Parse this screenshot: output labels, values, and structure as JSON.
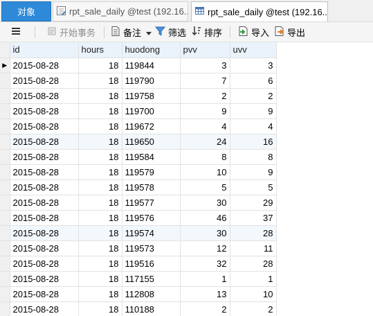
{
  "tabs": [
    {
      "label": "对象",
      "icon": "none"
    },
    {
      "label": "rpt_sale_daily @test (192.16...",
      "icon": "query-icon"
    },
    {
      "label": "rpt_sale_daily @test (192.16...",
      "icon": "table-icon"
    }
  ],
  "toolbar": {
    "menu_icon": "menu-icon",
    "begin_transaction": "开始事务",
    "memo": "备注",
    "filter": "筛选",
    "sort": "排序",
    "import": "导入",
    "export": "导出"
  },
  "grid": {
    "columns": [
      "id",
      "hours",
      "huodong",
      "pvv",
      "uvv"
    ],
    "current_row_indicator": "▶",
    "rows": [
      [
        "2015-08-28",
        "18",
        "119844",
        "3",
        "3"
      ],
      [
        "2015-08-28",
        "18",
        "119790",
        "7",
        "6"
      ],
      [
        "2015-08-28",
        "18",
        "119758",
        "2",
        "2"
      ],
      [
        "2015-08-28",
        "18",
        "119700",
        "9",
        "9"
      ],
      [
        "2015-08-28",
        "18",
        "119672",
        "4",
        "4"
      ],
      [
        "2015-08-28",
        "18",
        "119650",
        "24",
        "16"
      ],
      [
        "2015-08-28",
        "18",
        "119584",
        "8",
        "8"
      ],
      [
        "2015-08-28",
        "18",
        "119579",
        "10",
        "9"
      ],
      [
        "2015-08-28",
        "18",
        "119578",
        "5",
        "5"
      ],
      [
        "2015-08-28",
        "18",
        "119577",
        "30",
        "29"
      ],
      [
        "2015-08-28",
        "18",
        "119576",
        "46",
        "37"
      ],
      [
        "2015-08-28",
        "18",
        "119574",
        "30",
        "28"
      ],
      [
        "2015-08-28",
        "18",
        "119573",
        "12",
        "11"
      ],
      [
        "2015-08-28",
        "18",
        "119516",
        "32",
        "28"
      ],
      [
        "2015-08-28",
        "18",
        "117155",
        "1",
        "1"
      ],
      [
        "2015-08-28",
        "18",
        "112808",
        "13",
        "10"
      ],
      [
        "2015-08-28",
        "18",
        "110188",
        "2",
        "2"
      ]
    ]
  }
}
